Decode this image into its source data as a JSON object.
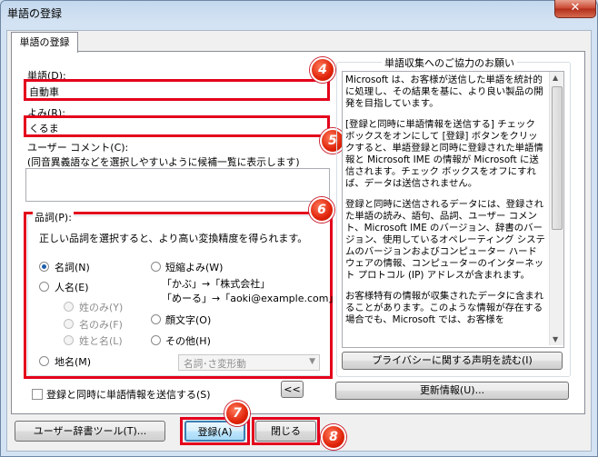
{
  "window": {
    "title": "単語の登録",
    "close_glyph": "✕"
  },
  "tab": {
    "label": "単語の登録"
  },
  "word": {
    "label": "単語(D):",
    "value": "自動車"
  },
  "yomi": {
    "label": "よみ(R):",
    "value": "くるま"
  },
  "comment": {
    "label": "ユーザー コメント(C):",
    "hint": "(同音異義語などを選択しやすいように候補一覧に表示します)",
    "value": ""
  },
  "hinshi": {
    "label": "品詞(P):",
    "description": "正しい品詞を選択すると、より高い変換精度を得られます。",
    "options": {
      "meishi": "名詞(N)",
      "jinmei": "人名(E)",
      "sei_nomi": "姓のみ(Y)",
      "mei_nomi": "名のみ(F)",
      "sei_to_mei": "姓と名(L)",
      "chimei": "地名(M)",
      "tanshuku": "短縮よみ(W)",
      "tanshuku_example1": "「かぶ」→「株式会社」",
      "tanshuku_example2": "「めーる」→「aoki@example.com」",
      "kaomoji": "顔文字(O)",
      "sonota": "その他(H)"
    },
    "sonota_select": "名詞･さ変形動"
  },
  "send_checkbox": {
    "label": "登録と同時に単語情報を送信する(S)",
    "checked": false
  },
  "collapse_button": "<<",
  "info_group": {
    "label": "単語収集へのご協力のお願い",
    "paragraphs": [
      "Microsoft は、お客様が送信した単語を統計的に処理し、その結果を基に、より良い製品の開発を目指しています。",
      "[登録と同時に単語情報を送信する] チェック ボックスをオンにして [登録] ボタンをクリックすると、単語登録と同時に登録された単語情報と Microsoft IME の情報が Microsoft に送信されます。チェック ボックスをオフにすれば、データは送信されません。",
      "登録と同時に送信されるデータには、登録された単語の読み、語句、品詞、ユーザー コメント、Microsoft IME のバージョン、辞書のバージョン、使用しているオペレーティング システムのバージョンおよびコンピューター ハードウェアの情報、コンピューターのインターネット プロトコル (IP) アドレスが含まれます。",
      "お客様特有の情報が収集されたデータに含まれることがあります。このような情報が存在する場合でも、Microsoft では、お客様を"
    ],
    "privacy_button": "プライバシーに関する声明を読む(I)"
  },
  "update_button": "更新情報(U)...",
  "footer": {
    "dict_tool_button": "ユーザー辞書ツール(T)...",
    "register_button": "登録(A)",
    "close_button": "閉じる"
  },
  "badges": {
    "b4": "4",
    "b5": "5",
    "b6": "6",
    "b7": "7",
    "b8": "8"
  }
}
